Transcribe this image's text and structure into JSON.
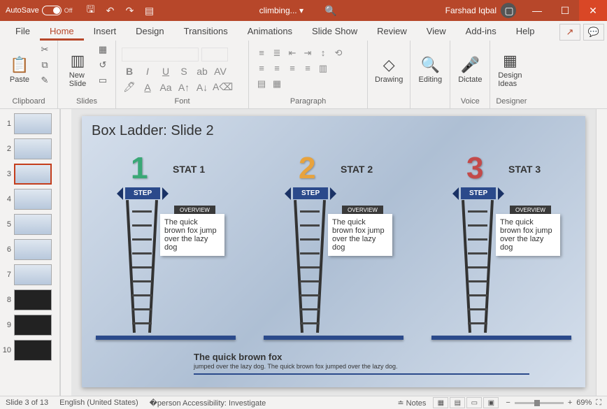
{
  "titlebar": {
    "autosave_label": "AutoSave",
    "autosave_state": "Off",
    "filename": "climbing...",
    "user": "Farshad Iqbal"
  },
  "tabs": [
    "File",
    "Home",
    "Insert",
    "Design",
    "Transitions",
    "Animations",
    "Slide Show",
    "Review",
    "View",
    "Add-ins",
    "Help"
  ],
  "active_tab": 1,
  "ribbon": {
    "clipboard": {
      "label": "Clipboard",
      "paste": "Paste"
    },
    "slides": {
      "label": "Slides",
      "new_slide": "New\nSlide"
    },
    "font": {
      "label": "Font"
    },
    "paragraph": {
      "label": "Paragraph"
    },
    "drawing": {
      "label": "Drawing",
      "btn": "Drawing"
    },
    "editing": {
      "label": "Editing",
      "btn": "Editing"
    },
    "voice": {
      "label": "Voice",
      "btn": "Dictate"
    },
    "designer": {
      "label": "Designer",
      "btn": "Design\nIdeas"
    }
  },
  "thumbnails": {
    "count": 10,
    "selected": 3,
    "dark_slides": [
      8,
      9,
      10
    ]
  },
  "slide": {
    "title": "Box Ladder: Slide 2",
    "step_label": "STEP",
    "overview_label": "OVERVIEW",
    "columns": [
      {
        "num": "1",
        "stat": "STAT 1",
        "body": "The quick brown fox jump over the lazy dog"
      },
      {
        "num": "2",
        "stat": "STAT 2",
        "body": "The quick brown fox jump over the lazy dog"
      },
      {
        "num": "3",
        "stat": "STAT 3",
        "body": "The quick brown fox jump over the lazy dog"
      }
    ],
    "footer_bold": "The quick brown fox",
    "footer_rest": "jumped over the lazy dog. The quick brown fox jumped over the lazy dog."
  },
  "statusbar": {
    "slide_indicator": "Slide 3 of 13",
    "language": "English (United States)",
    "accessibility": "Accessibility: Investigate",
    "notes": "Notes",
    "zoom": "69%"
  }
}
